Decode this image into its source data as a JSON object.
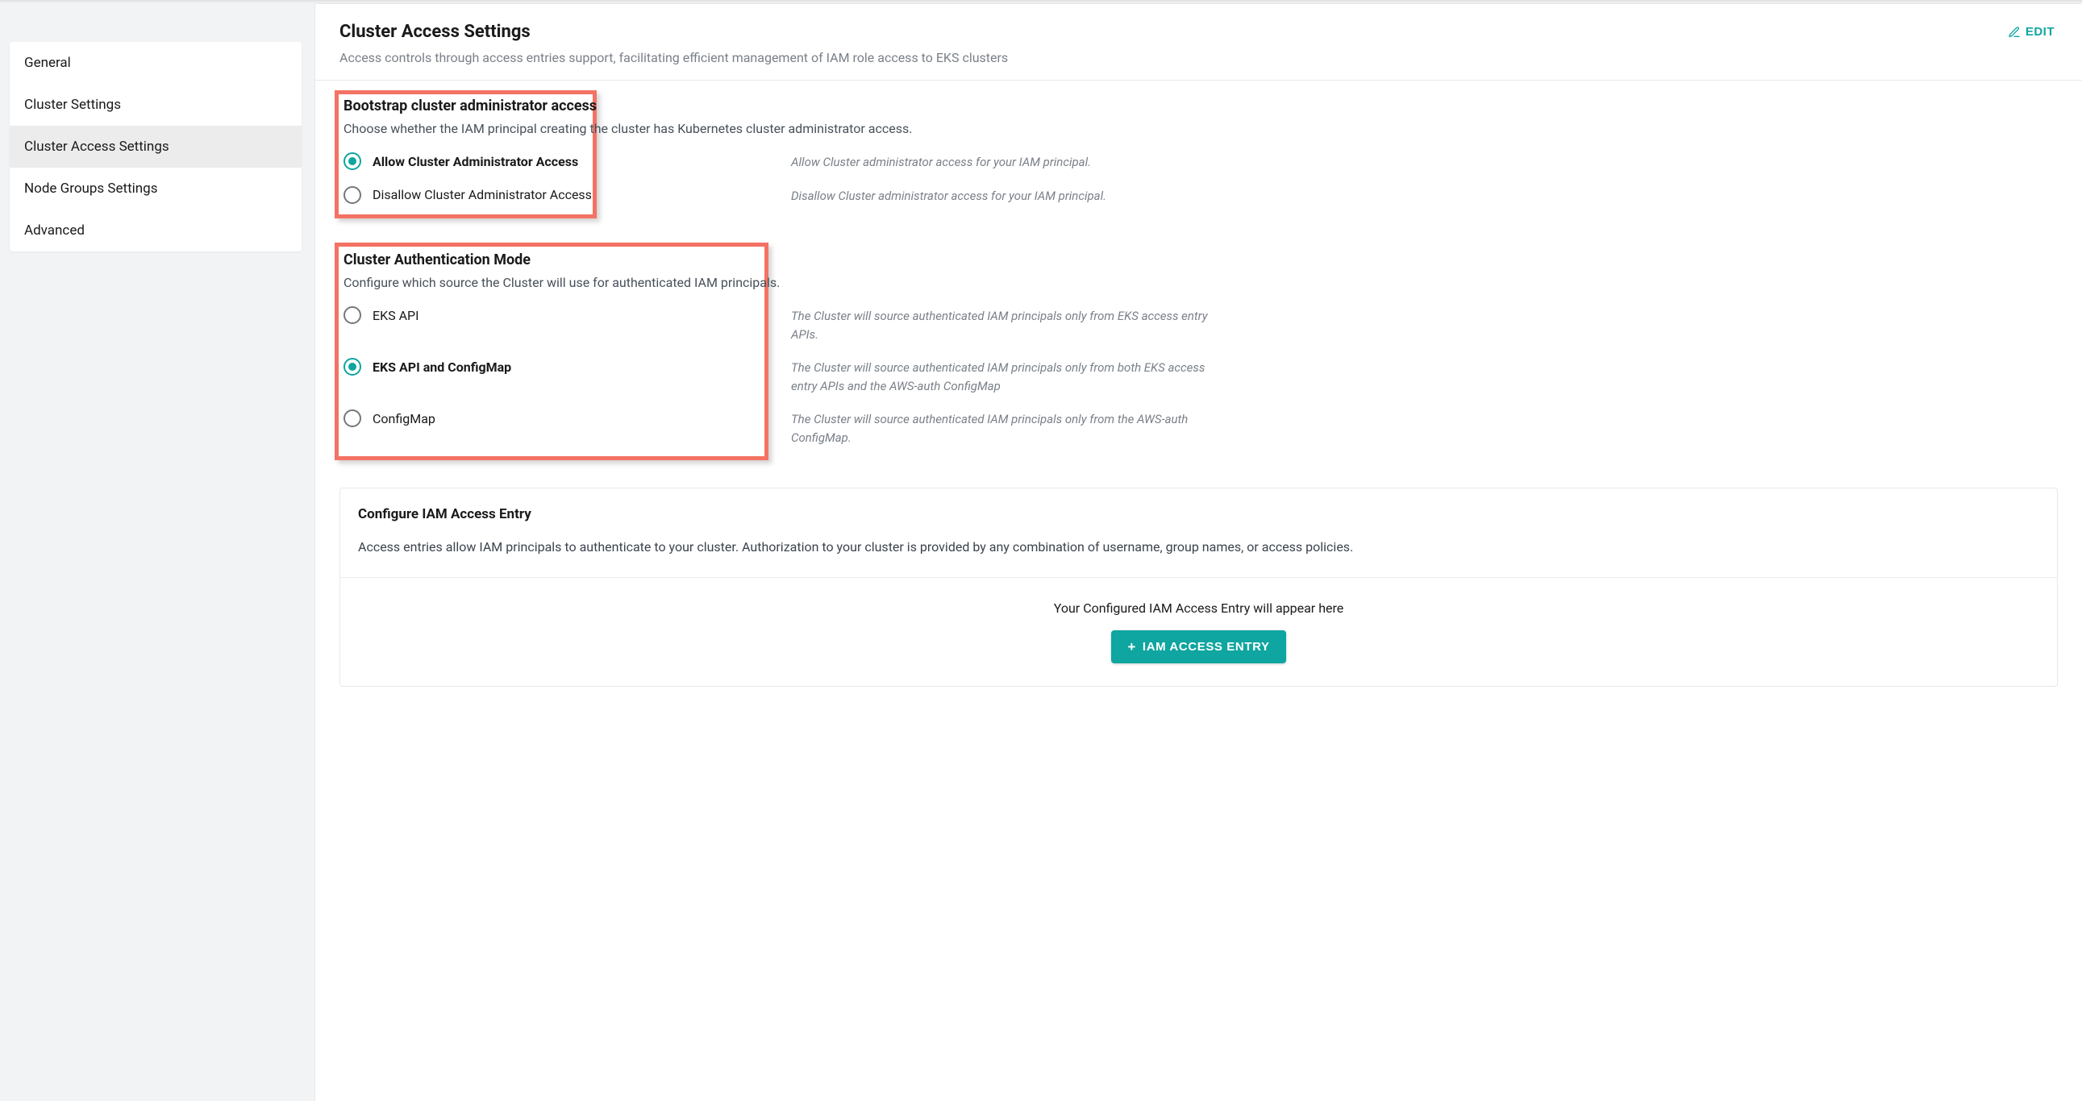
{
  "sidebar": {
    "items": [
      {
        "label": "General",
        "active": false
      },
      {
        "label": "Cluster Settings",
        "active": false
      },
      {
        "label": "Cluster Access Settings",
        "active": true
      },
      {
        "label": "Node Groups Settings",
        "active": false
      },
      {
        "label": "Advanced",
        "active": false
      }
    ]
  },
  "header": {
    "title": "Cluster Access Settings",
    "subtitle": "Access controls through access entries support, facilitating efficient management of IAM role access to EKS clusters",
    "edit_label": "EDIT"
  },
  "bootstrap": {
    "title": "Bootstrap cluster administrator access",
    "desc": "Choose whether the IAM principal creating the cluster has Kubernetes cluster administrator access.",
    "options": [
      {
        "label": "Allow Cluster Administrator Access",
        "help": "Allow Cluster administrator access for your IAM principal.",
        "checked": true
      },
      {
        "label": "Disallow Cluster Administrator Access",
        "help": "Disallow Cluster administrator access for your IAM principal.",
        "checked": false
      }
    ]
  },
  "authmode": {
    "title": "Cluster Authentication Mode",
    "desc": "Configure which source the Cluster will use for authenticated IAM principals.",
    "options": [
      {
        "label": "EKS API",
        "help": "The Cluster will source authenticated IAM principals only from EKS access entry APIs.",
        "checked": false
      },
      {
        "label": "EKS API and ConfigMap",
        "help": "The Cluster will source authenticated IAM principals only from both EKS access entry APIs and the AWS-auth ConfigMap",
        "checked": true
      },
      {
        "label": "ConfigMap",
        "help": "The Cluster will source authenticated IAM principals only from the AWS-auth ConfigMap.",
        "checked": false
      }
    ]
  },
  "iam_card": {
    "title": "Configure IAM Access Entry",
    "desc": "Access entries allow IAM principals to authenticate to your cluster. Authorization to your cluster is provided by any combination of username, group names, or access policies.",
    "empty_msg": "Your Configured IAM Access Entry will appear here",
    "button_label": "IAM ACCESS ENTRY"
  }
}
